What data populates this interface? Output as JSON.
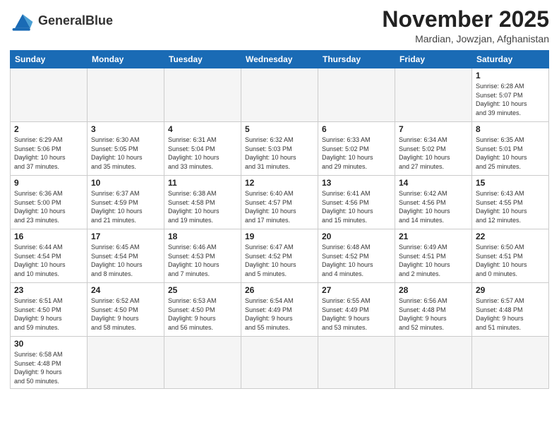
{
  "logo": {
    "text_normal": "General",
    "text_bold": "Blue"
  },
  "header": {
    "month": "November 2025",
    "location": "Mardian, Jowzjan, Afghanistan"
  },
  "weekdays": [
    "Sunday",
    "Monday",
    "Tuesday",
    "Wednesday",
    "Thursday",
    "Friday",
    "Saturday"
  ],
  "weeks": [
    [
      {
        "day": "",
        "empty": true
      },
      {
        "day": "",
        "empty": true
      },
      {
        "day": "",
        "empty": true
      },
      {
        "day": "",
        "empty": true
      },
      {
        "day": "",
        "empty": true
      },
      {
        "day": "",
        "empty": true
      },
      {
        "day": "1",
        "info": "Sunrise: 6:28 AM\nSunset: 5:07 PM\nDaylight: 10 hours\nand 39 minutes."
      }
    ],
    [
      {
        "day": "2",
        "info": "Sunrise: 6:29 AM\nSunset: 5:06 PM\nDaylight: 10 hours\nand 37 minutes."
      },
      {
        "day": "3",
        "info": "Sunrise: 6:30 AM\nSunset: 5:05 PM\nDaylight: 10 hours\nand 35 minutes."
      },
      {
        "day": "4",
        "info": "Sunrise: 6:31 AM\nSunset: 5:04 PM\nDaylight: 10 hours\nand 33 minutes."
      },
      {
        "day": "5",
        "info": "Sunrise: 6:32 AM\nSunset: 5:03 PM\nDaylight: 10 hours\nand 31 minutes."
      },
      {
        "day": "6",
        "info": "Sunrise: 6:33 AM\nSunset: 5:02 PM\nDaylight: 10 hours\nand 29 minutes."
      },
      {
        "day": "7",
        "info": "Sunrise: 6:34 AM\nSunset: 5:02 PM\nDaylight: 10 hours\nand 27 minutes."
      },
      {
        "day": "8",
        "info": "Sunrise: 6:35 AM\nSunset: 5:01 PM\nDaylight: 10 hours\nand 25 minutes."
      }
    ],
    [
      {
        "day": "9",
        "info": "Sunrise: 6:36 AM\nSunset: 5:00 PM\nDaylight: 10 hours\nand 23 minutes."
      },
      {
        "day": "10",
        "info": "Sunrise: 6:37 AM\nSunset: 4:59 PM\nDaylight: 10 hours\nand 21 minutes."
      },
      {
        "day": "11",
        "info": "Sunrise: 6:38 AM\nSunset: 4:58 PM\nDaylight: 10 hours\nand 19 minutes."
      },
      {
        "day": "12",
        "info": "Sunrise: 6:40 AM\nSunset: 4:57 PM\nDaylight: 10 hours\nand 17 minutes."
      },
      {
        "day": "13",
        "info": "Sunrise: 6:41 AM\nSunset: 4:56 PM\nDaylight: 10 hours\nand 15 minutes."
      },
      {
        "day": "14",
        "info": "Sunrise: 6:42 AM\nSunset: 4:56 PM\nDaylight: 10 hours\nand 14 minutes."
      },
      {
        "day": "15",
        "info": "Sunrise: 6:43 AM\nSunset: 4:55 PM\nDaylight: 10 hours\nand 12 minutes."
      }
    ],
    [
      {
        "day": "16",
        "info": "Sunrise: 6:44 AM\nSunset: 4:54 PM\nDaylight: 10 hours\nand 10 minutes."
      },
      {
        "day": "17",
        "info": "Sunrise: 6:45 AM\nSunset: 4:54 PM\nDaylight: 10 hours\nand 8 minutes."
      },
      {
        "day": "18",
        "info": "Sunrise: 6:46 AM\nSunset: 4:53 PM\nDaylight: 10 hours\nand 7 minutes."
      },
      {
        "day": "19",
        "info": "Sunrise: 6:47 AM\nSunset: 4:52 PM\nDaylight: 10 hours\nand 5 minutes."
      },
      {
        "day": "20",
        "info": "Sunrise: 6:48 AM\nSunset: 4:52 PM\nDaylight: 10 hours\nand 4 minutes."
      },
      {
        "day": "21",
        "info": "Sunrise: 6:49 AM\nSunset: 4:51 PM\nDaylight: 10 hours\nand 2 minutes."
      },
      {
        "day": "22",
        "info": "Sunrise: 6:50 AM\nSunset: 4:51 PM\nDaylight: 10 hours\nand 0 minutes."
      }
    ],
    [
      {
        "day": "23",
        "info": "Sunrise: 6:51 AM\nSunset: 4:50 PM\nDaylight: 9 hours\nand 59 minutes."
      },
      {
        "day": "24",
        "info": "Sunrise: 6:52 AM\nSunset: 4:50 PM\nDaylight: 9 hours\nand 58 minutes."
      },
      {
        "day": "25",
        "info": "Sunrise: 6:53 AM\nSunset: 4:50 PM\nDaylight: 9 hours\nand 56 minutes."
      },
      {
        "day": "26",
        "info": "Sunrise: 6:54 AM\nSunset: 4:49 PM\nDaylight: 9 hours\nand 55 minutes."
      },
      {
        "day": "27",
        "info": "Sunrise: 6:55 AM\nSunset: 4:49 PM\nDaylight: 9 hours\nand 53 minutes."
      },
      {
        "day": "28",
        "info": "Sunrise: 6:56 AM\nSunset: 4:48 PM\nDaylight: 9 hours\nand 52 minutes."
      },
      {
        "day": "29",
        "info": "Sunrise: 6:57 AM\nSunset: 4:48 PM\nDaylight: 9 hours\nand 51 minutes."
      }
    ],
    [
      {
        "day": "30",
        "info": "Sunrise: 6:58 AM\nSunset: 4:48 PM\nDaylight: 9 hours\nand 50 minutes."
      },
      {
        "day": "",
        "empty": true
      },
      {
        "day": "",
        "empty": true
      },
      {
        "day": "",
        "empty": true
      },
      {
        "day": "",
        "empty": true
      },
      {
        "day": "",
        "empty": true
      },
      {
        "day": "",
        "empty": true
      }
    ]
  ]
}
